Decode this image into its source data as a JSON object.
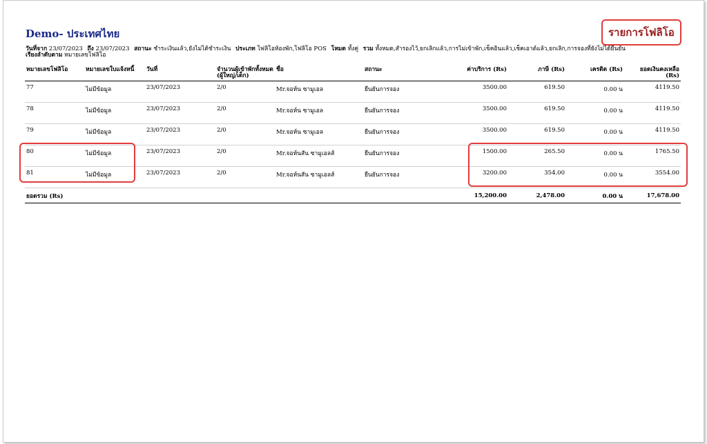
{
  "header": {
    "company": "Demo- ประเทศไทย",
    "report_title": "รายการโฟลิโอ"
  },
  "criteria": {
    "from_label": "วันที่จาก",
    "from_value": "23/07/2023",
    "to_label": "ถึง",
    "to_value": "23/07/2023",
    "status_label": "สถานะ",
    "status_value": "ชำระเงินแล้ว,ยังไม่ได้ชำระเงิน",
    "type_label": "ประเภท",
    "type_value": "โฟลิโอห้องพัก,โฟลิโอ POS",
    "mode_label": "โหมด",
    "mode_value": "ทั้งคู่",
    "include_label": "รวม",
    "include_value": "ทั้งหมด,สำรองไว้,ยกเลิกแล้ว,การไม่เข้าพัก,เช็คอินแล้ว,เช็คเอาต์แล้ว,ยกเลิก,การจองที่ยังไม่ได้ยืนยัน",
    "sort_label": "เรียงลำดับตาม",
    "sort_value": "หมายเลขโฟลิโอ"
  },
  "table": {
    "columns": [
      "หมายเลขโฟลิโอ",
      "หมายเลขใบแจ้งหนี้",
      "วันที่",
      "จำนวนผู้เข้าพักทั้งหมด (ผู้ใหญ่/เด็ก)",
      "ชื่อ",
      "สถานะ",
      "ค่าบริการ (Rs)",
      "ภาษี (Rs)",
      "เครดิต (Rs)",
      "ยอดเงินคงเหลือ (Rs)"
    ],
    "rows": [
      [
        "77",
        "ไม่มีข้อมูล",
        "23/07/2023",
        "2/0",
        "Mr.จอห์น ซามูเอล",
        "ยืนยันการจอง",
        "3500.00",
        "619.50",
        "0.00 น",
        "4119.50"
      ],
      [
        "78",
        "ไม่มีข้อมูล",
        "23/07/2023",
        "2/0",
        "Mr.จอห์น ซามูเอล",
        "ยืนยันการจอง",
        "3500.00",
        "619.50",
        "0.00 น",
        "4119.50"
      ],
      [
        "79",
        "ไม่มีข้อมูล",
        "23/07/2023",
        "2/0",
        "Mr.จอห์น ซามูเอล",
        "ยืนยันการจอง",
        "3500.00",
        "619.50",
        "0.00 น",
        "4119.50"
      ],
      [
        "80",
        "ไม่มีข้อมูล",
        "23/07/2023",
        "2/0",
        "Mr.จอห์นสัน ซามูเอลส์",
        "ยืนยันการจอง",
        "1500.00",
        "265.50",
        "0.00 น",
        "1765.50"
      ],
      [
        "81",
        "ไม่มีข้อมูล",
        "23/07/2023",
        "2/0",
        "Mr.จอห์นสัน ซามูเอลส์",
        "ยืนยันการจอง",
        "3200.00",
        "354.00",
        "0.00 น",
        "3554.00"
      ]
    ],
    "total": {
      "label": "ยอดรวม (Rs)",
      "charges": "15,200.00",
      "tax": "2,478.00",
      "credit": "0.00 น",
      "balance": "17,678.00"
    }
  },
  "colors": {
    "title_blue": "#1b2a8a",
    "report_title_red": "#9a1a1a",
    "highlight_red": "#e23a3a"
  }
}
